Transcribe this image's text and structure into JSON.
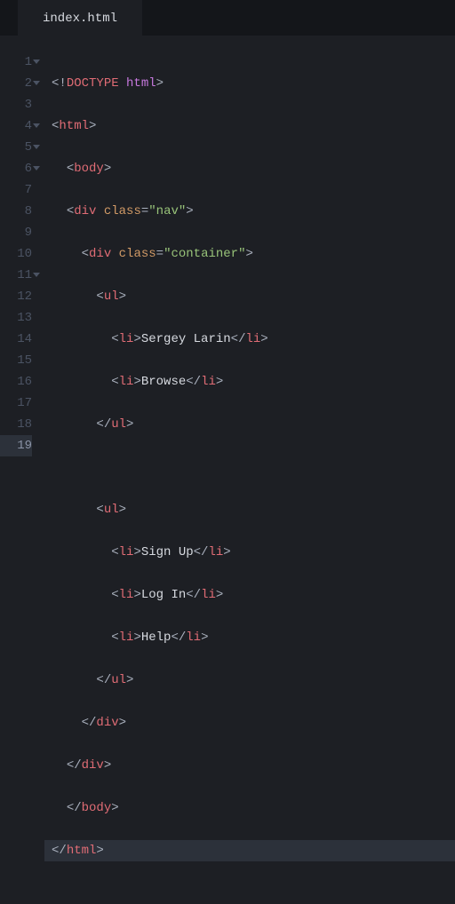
{
  "tab": {
    "title": "index.html"
  },
  "lines": {
    "l1": {
      "num": "1",
      "doctype_bang": "<!",
      "doctype_word": "DOCTYPE",
      "doctype_kw": " html",
      "doctype_close": ">",
      "fold": true
    },
    "l2": {
      "num": "2",
      "open": "<",
      "tag": "html",
      "close": ">",
      "fold": true
    },
    "l3": {
      "num": "3",
      "indent": "  ",
      "open": "<",
      "tag": "body",
      "close": ">"
    },
    "l4": {
      "num": "4",
      "indent": "  ",
      "open": "<",
      "tag": "div",
      "sp": " ",
      "attr": "class",
      "eq": "=",
      "val": "\"nav\"",
      "close": ">",
      "fold": true
    },
    "l5": {
      "num": "5",
      "indent": "    ",
      "open": "<",
      "tag": "div",
      "sp": " ",
      "attr": "class",
      "eq": "=",
      "val": "\"container\"",
      "close": ">",
      "fold": true
    },
    "l6": {
      "num": "6",
      "indent": "      ",
      "open": "<",
      "tag": "ul",
      "close": ">",
      "fold": true
    },
    "l7": {
      "num": "7",
      "indent": "        ",
      "open": "<",
      "tag": "li",
      "mid": ">",
      "text": "Sergey Larin",
      "copen": "</",
      "ctag": "li",
      "cclose": ">"
    },
    "l8": {
      "num": "8",
      "indent": "        ",
      "open": "<",
      "tag": "li",
      "mid": ">",
      "text": "Browse",
      "copen": "</",
      "ctag": "li",
      "cclose": ">"
    },
    "l9": {
      "num": "9",
      "indent": "      ",
      "open": "</",
      "tag": "ul",
      "close": ">"
    },
    "l10": {
      "num": "10",
      "indent": ""
    },
    "l11": {
      "num": "11",
      "indent": "      ",
      "open": "<",
      "tag": "ul",
      "close": ">",
      "fold": true
    },
    "l12": {
      "num": "12",
      "indent": "        ",
      "open": "<",
      "tag": "li",
      "mid": ">",
      "text": "Sign Up",
      "copen": "</",
      "ctag": "li",
      "cclose": ">"
    },
    "l13": {
      "num": "13",
      "indent": "        ",
      "open": "<",
      "tag": "li",
      "mid": ">",
      "text": "Log In",
      "copen": "</",
      "ctag": "li",
      "cclose": ">"
    },
    "l14": {
      "num": "14",
      "indent": "        ",
      "open": "<",
      "tag": "li",
      "mid": ">",
      "text": "Help",
      "copen": "</",
      "ctag": "li",
      "cclose": ">"
    },
    "l15": {
      "num": "15",
      "indent": "      ",
      "open": "</",
      "tag": "ul",
      "close": ">"
    },
    "l16": {
      "num": "16",
      "indent": "    ",
      "open": "</",
      "tag": "div",
      "close": ">"
    },
    "l17": {
      "num": "17",
      "indent": "  ",
      "open": "</",
      "tag": "div",
      "close": ">"
    },
    "l18": {
      "num": "18",
      "indent": "  ",
      "open": "</",
      "tag": "body",
      "close": ">"
    },
    "l19": {
      "num": "19",
      "indent": "",
      "open": "</",
      "tag": "html",
      "close": ">",
      "highlight": true
    }
  }
}
